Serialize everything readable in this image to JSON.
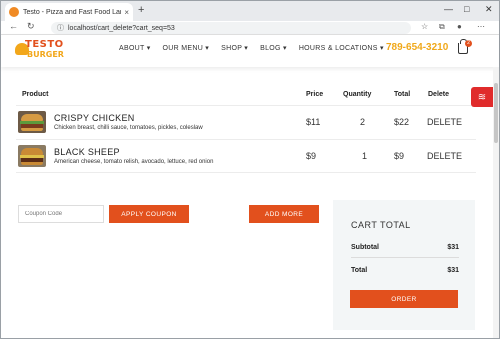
{
  "browser": {
    "tab_title": "Testo - Pizza and Fast Food Lanc",
    "tab_close": "×",
    "new_tab": "+",
    "url": "localhost/cart_delete?cart_seq=53",
    "win_min": "—",
    "win_max": "□",
    "win_close": "✕"
  },
  "header": {
    "logo_line1": "TESTO",
    "logo_line2": "BURGER",
    "menu": [
      "ABOUT ▾",
      "OUR MENU ▾",
      "SHOP ▾",
      "BLOG ▾",
      "HOURS & LOCATIONS ▾"
    ],
    "phone": "789-654-3210",
    "cart_count": "2"
  },
  "table": {
    "headers": {
      "product": "Product",
      "price": "Price",
      "quantity": "Quantity",
      "total": "Total",
      "delete": "Delete"
    },
    "rows": [
      {
        "name": "CRISPY CHICKEN",
        "desc": "Chicken breast, chilli sauce, tomatoes, pickles, coleslaw",
        "price": "$11",
        "qty": "2",
        "total": "$22",
        "delete": "DELETE"
      },
      {
        "name": "BLACK SHEEP",
        "desc": "American cheese, tomato relish, avocado, lettuce, red onion",
        "price": "$9",
        "qty": "1",
        "total": "$9",
        "delete": "DELETE"
      }
    ]
  },
  "coupon": {
    "placeholder": "Coupon Code",
    "apply_label": "APPLY COUPON",
    "add_more_label": "ADD MORE"
  },
  "totals": {
    "title": "CART TOTAL",
    "subtotal_label": "Subtotal",
    "subtotal_value": "$31",
    "total_label": "Total",
    "total_value": "$31",
    "order_label": "ORDER"
  },
  "colors": {
    "accent": "#e2501d",
    "phone": "#f0a81a",
    "widget": "#e02b2b"
  },
  "icons": {
    "back": "back-arrow-icon",
    "refresh": "refresh-icon",
    "info": "info-icon",
    "cart": "cart-icon",
    "layers": "layers-icon"
  }
}
